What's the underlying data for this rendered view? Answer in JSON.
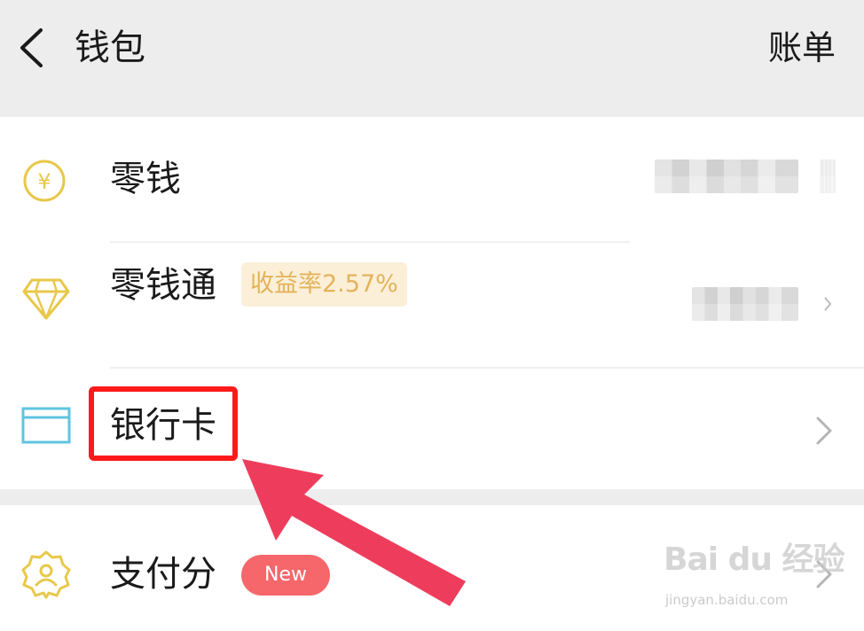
{
  "header": {
    "title": "钱包",
    "bill_label": "账单"
  },
  "items": [
    {
      "label": "零钱",
      "icon": "yuan-coin-icon"
    },
    {
      "label": "零钱通",
      "icon": "diamond-icon",
      "badge": "收益率2.57%"
    },
    {
      "label": "银行卡",
      "icon": "bank-card-icon"
    },
    {
      "label": "支付分",
      "icon": "payscore-badge-icon",
      "badge": "New"
    }
  ],
  "watermark": {
    "main": "Bai du 经验",
    "sub": "jingyan.baidu.com"
  },
  "colors": {
    "accent_yellow": "#e8c84a",
    "card_icon_blue": "#5fc4e0",
    "rate_badge_bg": "#fcefd8",
    "rate_badge_text": "#e3b35a",
    "new_badge_bg": "#f5676a",
    "annotation_red": "#ff1a1a",
    "arrow_pink": "#ee3d5c"
  }
}
